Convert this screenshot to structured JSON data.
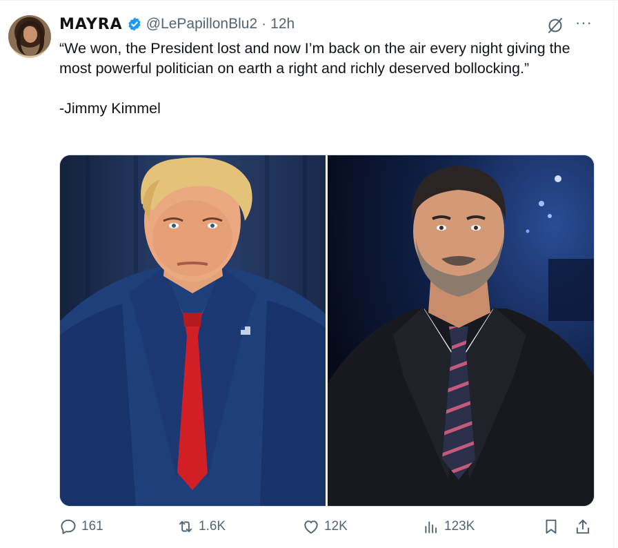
{
  "user": {
    "display_name": "MAYRA",
    "handle": "@LePapillonBlu2",
    "separator": "·",
    "time": "12h",
    "verified": true,
    "avatar_icon": "user-avatar"
  },
  "tweet": {
    "text": "“We won, the President lost and now I’m back on the air every night giving the most powerful politician on earth a right and richly deserved bollocking.”\n\n-Jimmy Kimmel"
  },
  "media": {
    "left_image": "photo-man-blue-suit-red-tie",
    "right_image": "photo-man-dark-suit-striped-tie"
  },
  "actions": {
    "replies": "161",
    "reposts": "1.6K",
    "likes": "12K",
    "views": "123K"
  },
  "colors": {
    "text": "#0f1419",
    "secondary": "#536471",
    "verified": "#1d9bf0",
    "border": "#cfd9de"
  },
  "icons": {
    "verified": "verified-badge-icon",
    "grok": "grok-icon",
    "more": "more-icon",
    "reply": "reply-icon",
    "repost": "repost-icon",
    "like": "heart-icon",
    "views": "views-icon",
    "bookmark": "bookmark-icon",
    "share": "share-icon"
  }
}
